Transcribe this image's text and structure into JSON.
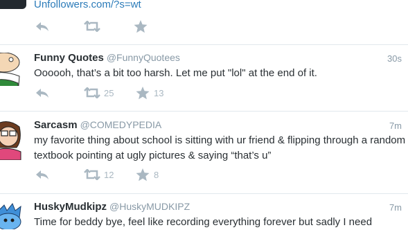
{
  "top_tweet": {
    "link": "Unfollowers.com/?s=wt"
  },
  "tweets": [
    {
      "name": "Funny Quotes",
      "handle": "@FunnyQuotees",
      "time": "30s",
      "text": "Oooooh, that’s a bit too harsh. Let me put \"lol\" at the end of it.",
      "retweets": "25",
      "favorites": "13"
    },
    {
      "name": "Sarcasm",
      "handle": "@COMEDYPEDIA",
      "time": "7m",
      "text": "my favorite thing about school is sitting with ur friend & flipping through a random textbook pointing at ugly pictures & saying “that’s u”",
      "retweets": "12",
      "favorites": "8"
    },
    {
      "name": "HuskyMudkipz",
      "handle": "@HuskyMUDKIPZ",
      "time": "7m",
      "text": "Time for beddy bye, feel like recording everything forever but sadly I need"
    }
  ],
  "colors": {
    "link": "#2b7bb9",
    "action_gray": "#aab8c2",
    "divider": "#e1e8ed"
  }
}
